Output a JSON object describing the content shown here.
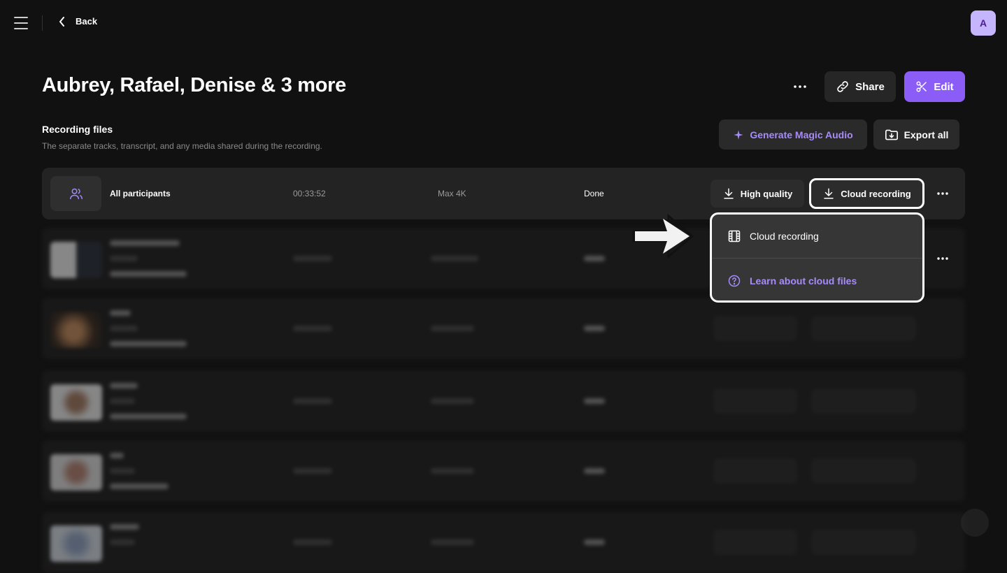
{
  "topbar": {
    "back_label": "Back",
    "avatar_initial": "A"
  },
  "header": {
    "title": "Aubrey, Rafael, Denise & 3 more",
    "share_label": "Share",
    "edit_label": "Edit"
  },
  "section": {
    "title": "Recording files",
    "subtitle": "The separate tracks, transcript, and any media shared during the recording.",
    "magic_audio_label": "Generate Magic Audio",
    "export_all_label": "Export all"
  },
  "main_row": {
    "name": "All participants",
    "duration": "00:33:52",
    "resolution": "Max 4K",
    "status": "Done",
    "high_quality_label": "High quality",
    "cloud_recording_label": "Cloud recording"
  },
  "dropdown": {
    "items": [
      {
        "label": "Cloud recording",
        "icon": "film-icon"
      },
      {
        "label": "Learn about cloud files",
        "icon": "help-circle-icon"
      }
    ]
  },
  "colors": {
    "accent": "#8b5cf6",
    "accent_text": "#a78bfa",
    "background": "#111111"
  }
}
